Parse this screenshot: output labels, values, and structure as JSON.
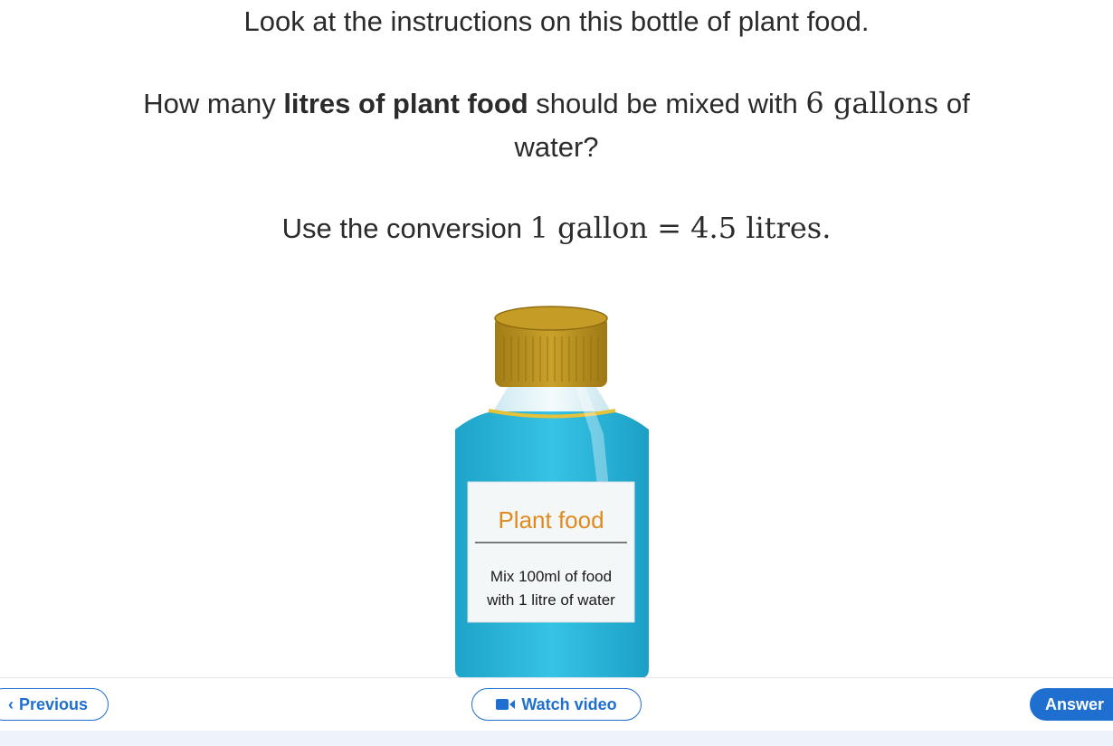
{
  "question": {
    "line1": "Look at the instructions on this bottle of plant food.",
    "line2_pre": "How many ",
    "line2_bold": "litres of plant food",
    "line2_mid": " should be mixed with ",
    "line2_math": "6 gallons",
    "line2_post": " of",
    "line3": "water?",
    "line4_pre": "Use the conversion ",
    "line4_math": "1 gallon = 4.5 litres.",
    "line4_post": ""
  },
  "bottle": {
    "label_title": "Plant food",
    "label_line1": "Mix 100ml of food",
    "label_line2": "with 1 litre of water"
  },
  "footer": {
    "previous_label": "Previous",
    "watch_label": "Watch video",
    "answer_label": "Answer"
  },
  "colors": {
    "accent": "#1f6fd0",
    "bottle_blue": "#2ab6d8",
    "cap_gold": "#b8911f",
    "label_title": "#e08a1e"
  }
}
